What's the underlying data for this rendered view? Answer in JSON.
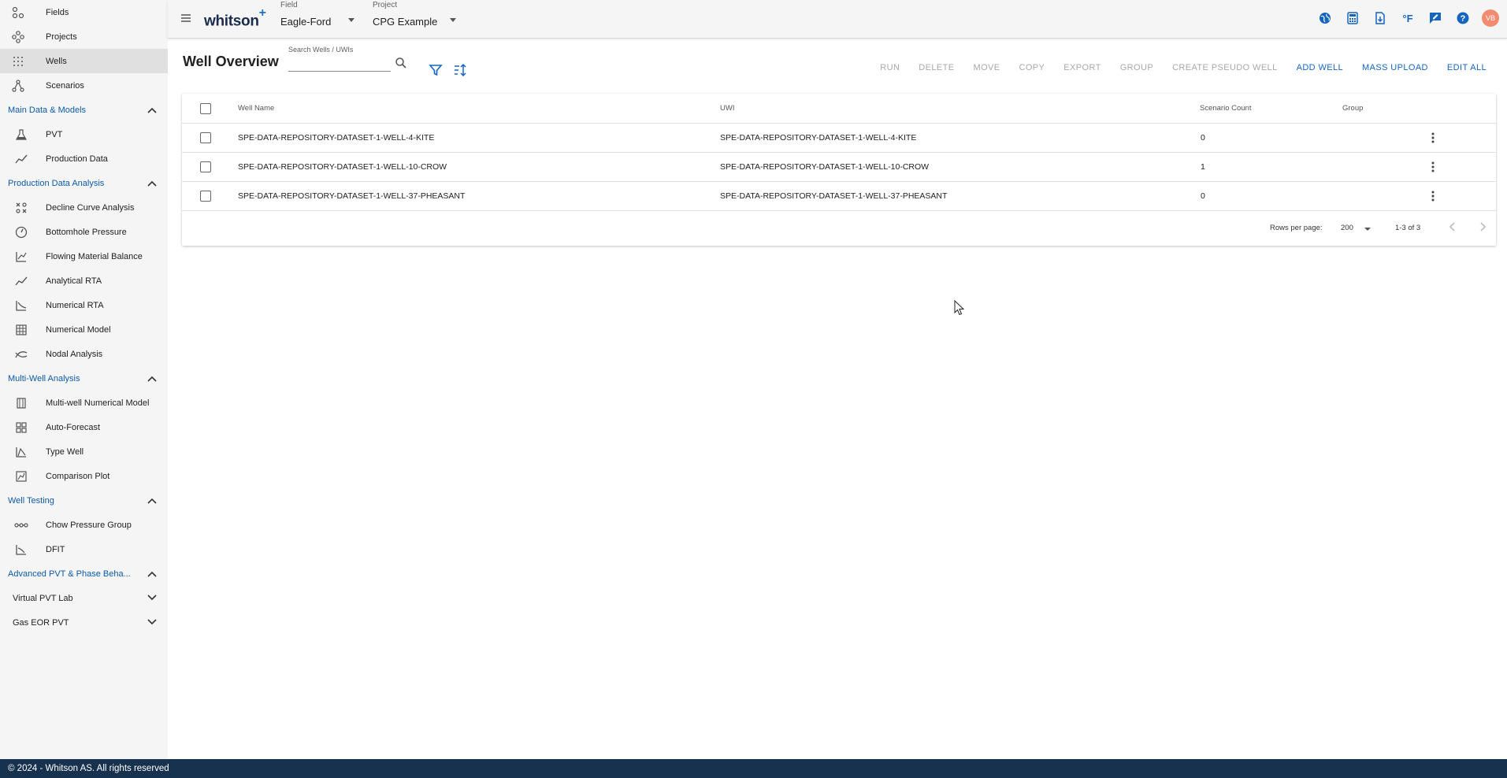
{
  "sidebar": {
    "top_items": [
      {
        "label": "Fields",
        "icon": "fields-icon"
      },
      {
        "label": "Projects",
        "icon": "projects-icon"
      },
      {
        "label": "Wells",
        "icon": "wells-icon",
        "active": true
      },
      {
        "label": "Scenarios",
        "icon": "scenarios-icon"
      }
    ],
    "sections": [
      {
        "title": "Main Data & Models",
        "items": [
          {
            "label": "PVT",
            "icon": "flask-icon"
          },
          {
            "label": "Production Data",
            "icon": "line-chart-icon"
          }
        ]
      },
      {
        "title": "Production Data Analysis",
        "items": [
          {
            "label": "Decline Curve Analysis",
            "icon": "decline-curve-icon"
          },
          {
            "label": "Bottomhole Pressure",
            "icon": "gauge-icon"
          },
          {
            "label": "Flowing Material Balance",
            "icon": "material-balance-icon"
          },
          {
            "label": "Analytical RTA",
            "icon": "analytical-rta-icon"
          },
          {
            "label": "Numerical RTA",
            "icon": "numerical-rta-icon"
          },
          {
            "label": "Numerical Model",
            "icon": "grid-model-icon"
          },
          {
            "label": "Nodal Analysis",
            "icon": "nodal-icon"
          }
        ]
      },
      {
        "title": "Multi-Well Analysis",
        "items": [
          {
            "label": "Multi-well Numerical Model",
            "icon": "multiwell-icon"
          },
          {
            "label": "Auto-Forecast",
            "icon": "auto-forecast-icon"
          },
          {
            "label": "Type Well",
            "icon": "type-well-icon"
          },
          {
            "label": "Comparison Plot",
            "icon": "comparison-plot-icon"
          }
        ]
      },
      {
        "title": "Well Testing",
        "items": [
          {
            "label": "Chow Pressure Group",
            "icon": "chow-icon"
          },
          {
            "label": "DFIT",
            "icon": "dfit-icon"
          }
        ]
      },
      {
        "title": "Advanced PVT & Phase Beha...",
        "items": []
      }
    ],
    "collapsed": [
      {
        "label": "Virtual PVT Lab"
      },
      {
        "label": "Gas EOR PVT"
      }
    ]
  },
  "topbar": {
    "logo": "whitson",
    "logo_plus": "+",
    "field_label": "Field",
    "field_value": "Eagle-Ford",
    "project_label": "Project",
    "project_value": "CPG Example",
    "units_label": "°F",
    "avatar_initials": "VB"
  },
  "main": {
    "title": "Well Overview",
    "search_label": "Search Wells / UWIs",
    "search_placeholder": "",
    "actions": [
      {
        "label": "RUN",
        "enabled": false
      },
      {
        "label": "DELETE",
        "enabled": false
      },
      {
        "label": "MOVE",
        "enabled": false
      },
      {
        "label": "COPY",
        "enabled": false
      },
      {
        "label": "EXPORT",
        "enabled": false
      },
      {
        "label": "GROUP",
        "enabled": false
      },
      {
        "label": "CREATE PSEUDO WELL",
        "enabled": false
      },
      {
        "label": "ADD WELL",
        "enabled": true
      },
      {
        "label": "MASS UPLOAD",
        "enabled": true
      },
      {
        "label": "EDIT ALL",
        "enabled": true
      }
    ]
  },
  "table": {
    "columns": {
      "name": "Well Name",
      "uwi": "UWI",
      "scenario_count": "Scenario Count",
      "group": "Group"
    },
    "rows": [
      {
        "name": "SPE-DATA-REPOSITORY-DATASET-1-WELL-4-KITE",
        "uwi": "SPE-DATA-REPOSITORY-DATASET-1-WELL-4-KITE",
        "scenario_count": "0",
        "group": ""
      },
      {
        "name": "SPE-DATA-REPOSITORY-DATASET-1-WELL-10-CROW",
        "uwi": "SPE-DATA-REPOSITORY-DATASET-1-WELL-10-CROW",
        "scenario_count": "1",
        "group": ""
      },
      {
        "name": "SPE-DATA-REPOSITORY-DATASET-1-WELL-37-PHEASANT",
        "uwi": "SPE-DATA-REPOSITORY-DATASET-1-WELL-37-PHEASANT",
        "scenario_count": "0",
        "group": ""
      }
    ],
    "rows_per_page_label": "Rows per page:",
    "rows_per_page_value": "200",
    "range": "1-3 of 3"
  },
  "footer": {
    "text": "© 2024 - Whitson AS. All rights reserved"
  },
  "colors": {
    "accent": "#1565c0",
    "section": "#0d5aa7",
    "footer": "#17324f",
    "avatar": "#f28b6f"
  }
}
